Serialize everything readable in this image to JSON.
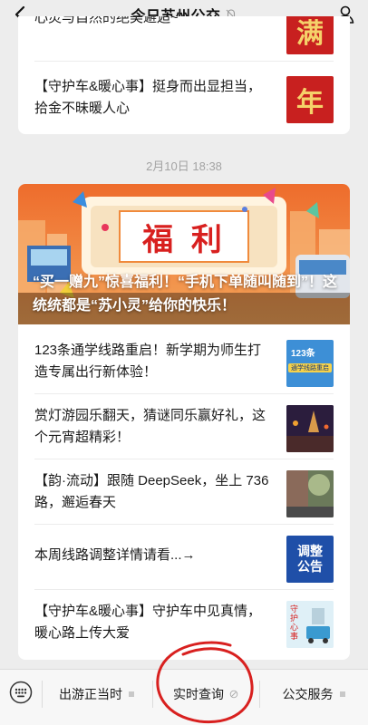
{
  "header": {
    "title": "今日苏州公交"
  },
  "card1": {
    "rows": [
      {
        "text": "心灵与自然的绝美邂逅~",
        "thumb_char": "满"
      },
      {
        "text": "【守护车&暖心事】挺身而出显担当，拾金不昧暖人心",
        "thumb_char": "年"
      }
    ]
  },
  "timestamp": "2月10日 18:38",
  "card2": {
    "banner": {
      "headline": "福 利",
      "caption": "“买一赠九”惊喜福利！“手机下单随叫随到”！这统统都是“苏小灵”给你的快乐！"
    },
    "rows": [
      {
        "text": "123条通学线路重启！新学期为师生打造专属出行新体验！",
        "thumb_tag": "123条",
        "thumb_sub": "通学线路重启"
      },
      {
        "text": "赏灯游园乐翻天，猜谜同乐赢好礼，这个元宵超精彩！"
      },
      {
        "text": "【韵·流动】跟随 DeepSeek，坐上 736路，邂逅春天"
      },
      {
        "text": "本周线路调整详情请看...→",
        "thumb_line1": "调整",
        "thumb_line2": "公告"
      },
      {
        "text": "【守护车&暖心事】守护车中见真情，暖心路上传大爱",
        "thumb_vert": "守护心事"
      }
    ]
  },
  "bottom_menu": {
    "tabs": [
      "出游正当时",
      "实时查询",
      "公交服务"
    ]
  },
  "colors": {
    "accent_red": "#c8201f",
    "banner_orange": "#f08a3c",
    "background": "#ededed",
    "circle_red": "#d8201f"
  }
}
